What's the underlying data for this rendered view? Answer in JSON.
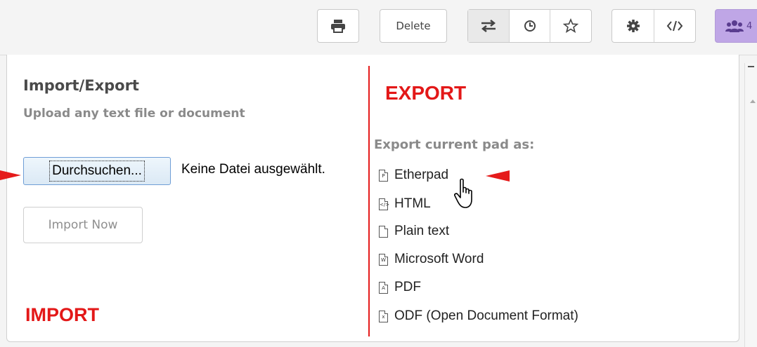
{
  "toolbar": {
    "delete_label": "Delete",
    "users_count": "4",
    "icons": [
      "print-icon",
      "sync-icon",
      "history-icon",
      "star-icon",
      "gear-icon",
      "code-icon",
      "users-icon"
    ]
  },
  "import_panel": {
    "title": "Import/Export",
    "subtitle": "Upload any text file or document",
    "browse_label": "Durchsuchen...",
    "file_status": "Keine Datei ausgewählt.",
    "import_button": "Import Now"
  },
  "export_panel": {
    "header": "Export current pad as:",
    "items": [
      {
        "label": "Etherpad",
        "icon": "etherpad-file-icon"
      },
      {
        "label": "HTML",
        "icon": "html-file-icon"
      },
      {
        "label": "Plain text",
        "icon": "plain-text-file-icon"
      },
      {
        "label": "Microsoft Word",
        "icon": "word-file-icon"
      },
      {
        "label": "PDF",
        "icon": "pdf-file-icon"
      },
      {
        "label": "ODF (Open Document Format)",
        "icon": "odf-file-icon"
      }
    ]
  },
  "annotations": {
    "import_label": "IMPORT",
    "export_label": "EXPORT",
    "color": "#e51b1b"
  },
  "colors": {
    "users_button": "#bfa6e6",
    "browse_border": "#6f9ed6"
  }
}
